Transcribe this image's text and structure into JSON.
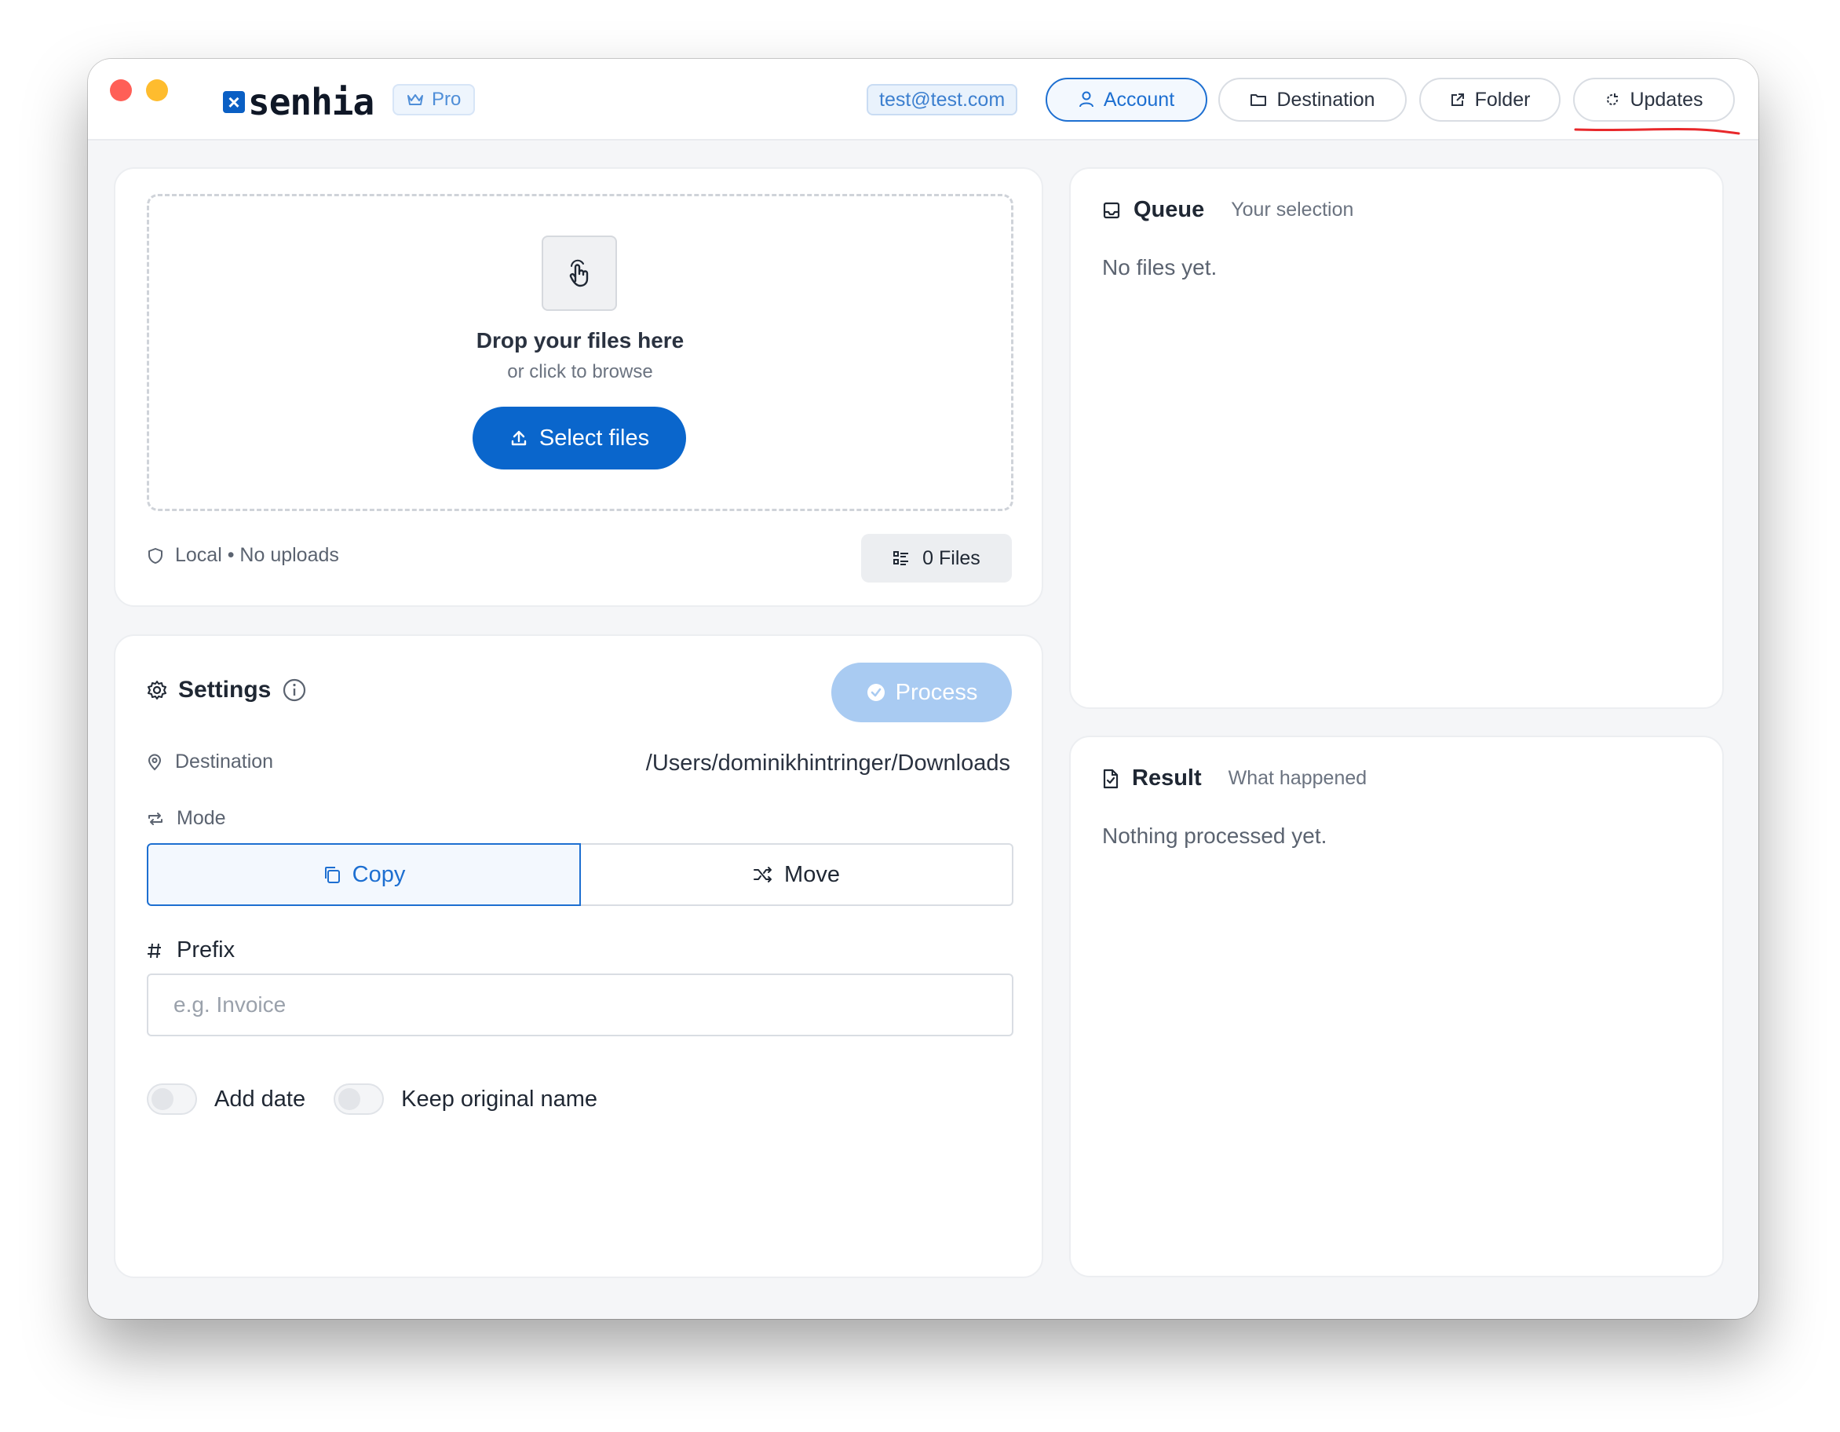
{
  "app": {
    "logo_mark": "×",
    "logo_text": "senhia",
    "plan_badge": "Pro",
    "user_email": "test@test.com"
  },
  "topbar": {
    "account_label": "Account",
    "destination_label": "Destination",
    "folder_label": "Folder",
    "updates_label": "Updates"
  },
  "upload": {
    "drop_title": "Drop your files here",
    "drop_subtitle": "or click to browse",
    "select_label": "Select files",
    "local_info": "Local • No uploads",
    "files_count_label": "0 Files"
  },
  "settings": {
    "title": "Settings",
    "process_label": "Process",
    "destination_label": "Destination",
    "destination_path": "/Users/dominikhintringer/Downloads",
    "mode_label": "Mode",
    "mode_options": [
      "Copy",
      "Move"
    ],
    "mode_selected": "Copy",
    "prefix_label": "Prefix",
    "prefix_value": "",
    "prefix_placeholder": "e.g. Invoice",
    "add_date_label": "Add date",
    "add_date_on": false,
    "keep_name_label": "Keep original name",
    "keep_name_on": false
  },
  "queue": {
    "title": "Queue",
    "subtitle": "Your selection",
    "empty_text": "No files yet."
  },
  "result": {
    "title": "Result",
    "subtitle": "What happened",
    "empty_text": "Nothing processed yet."
  },
  "colors": {
    "accent": "#0a66cc",
    "accent_light": "#a9cbf2",
    "annotation_red": "#e8282b"
  }
}
